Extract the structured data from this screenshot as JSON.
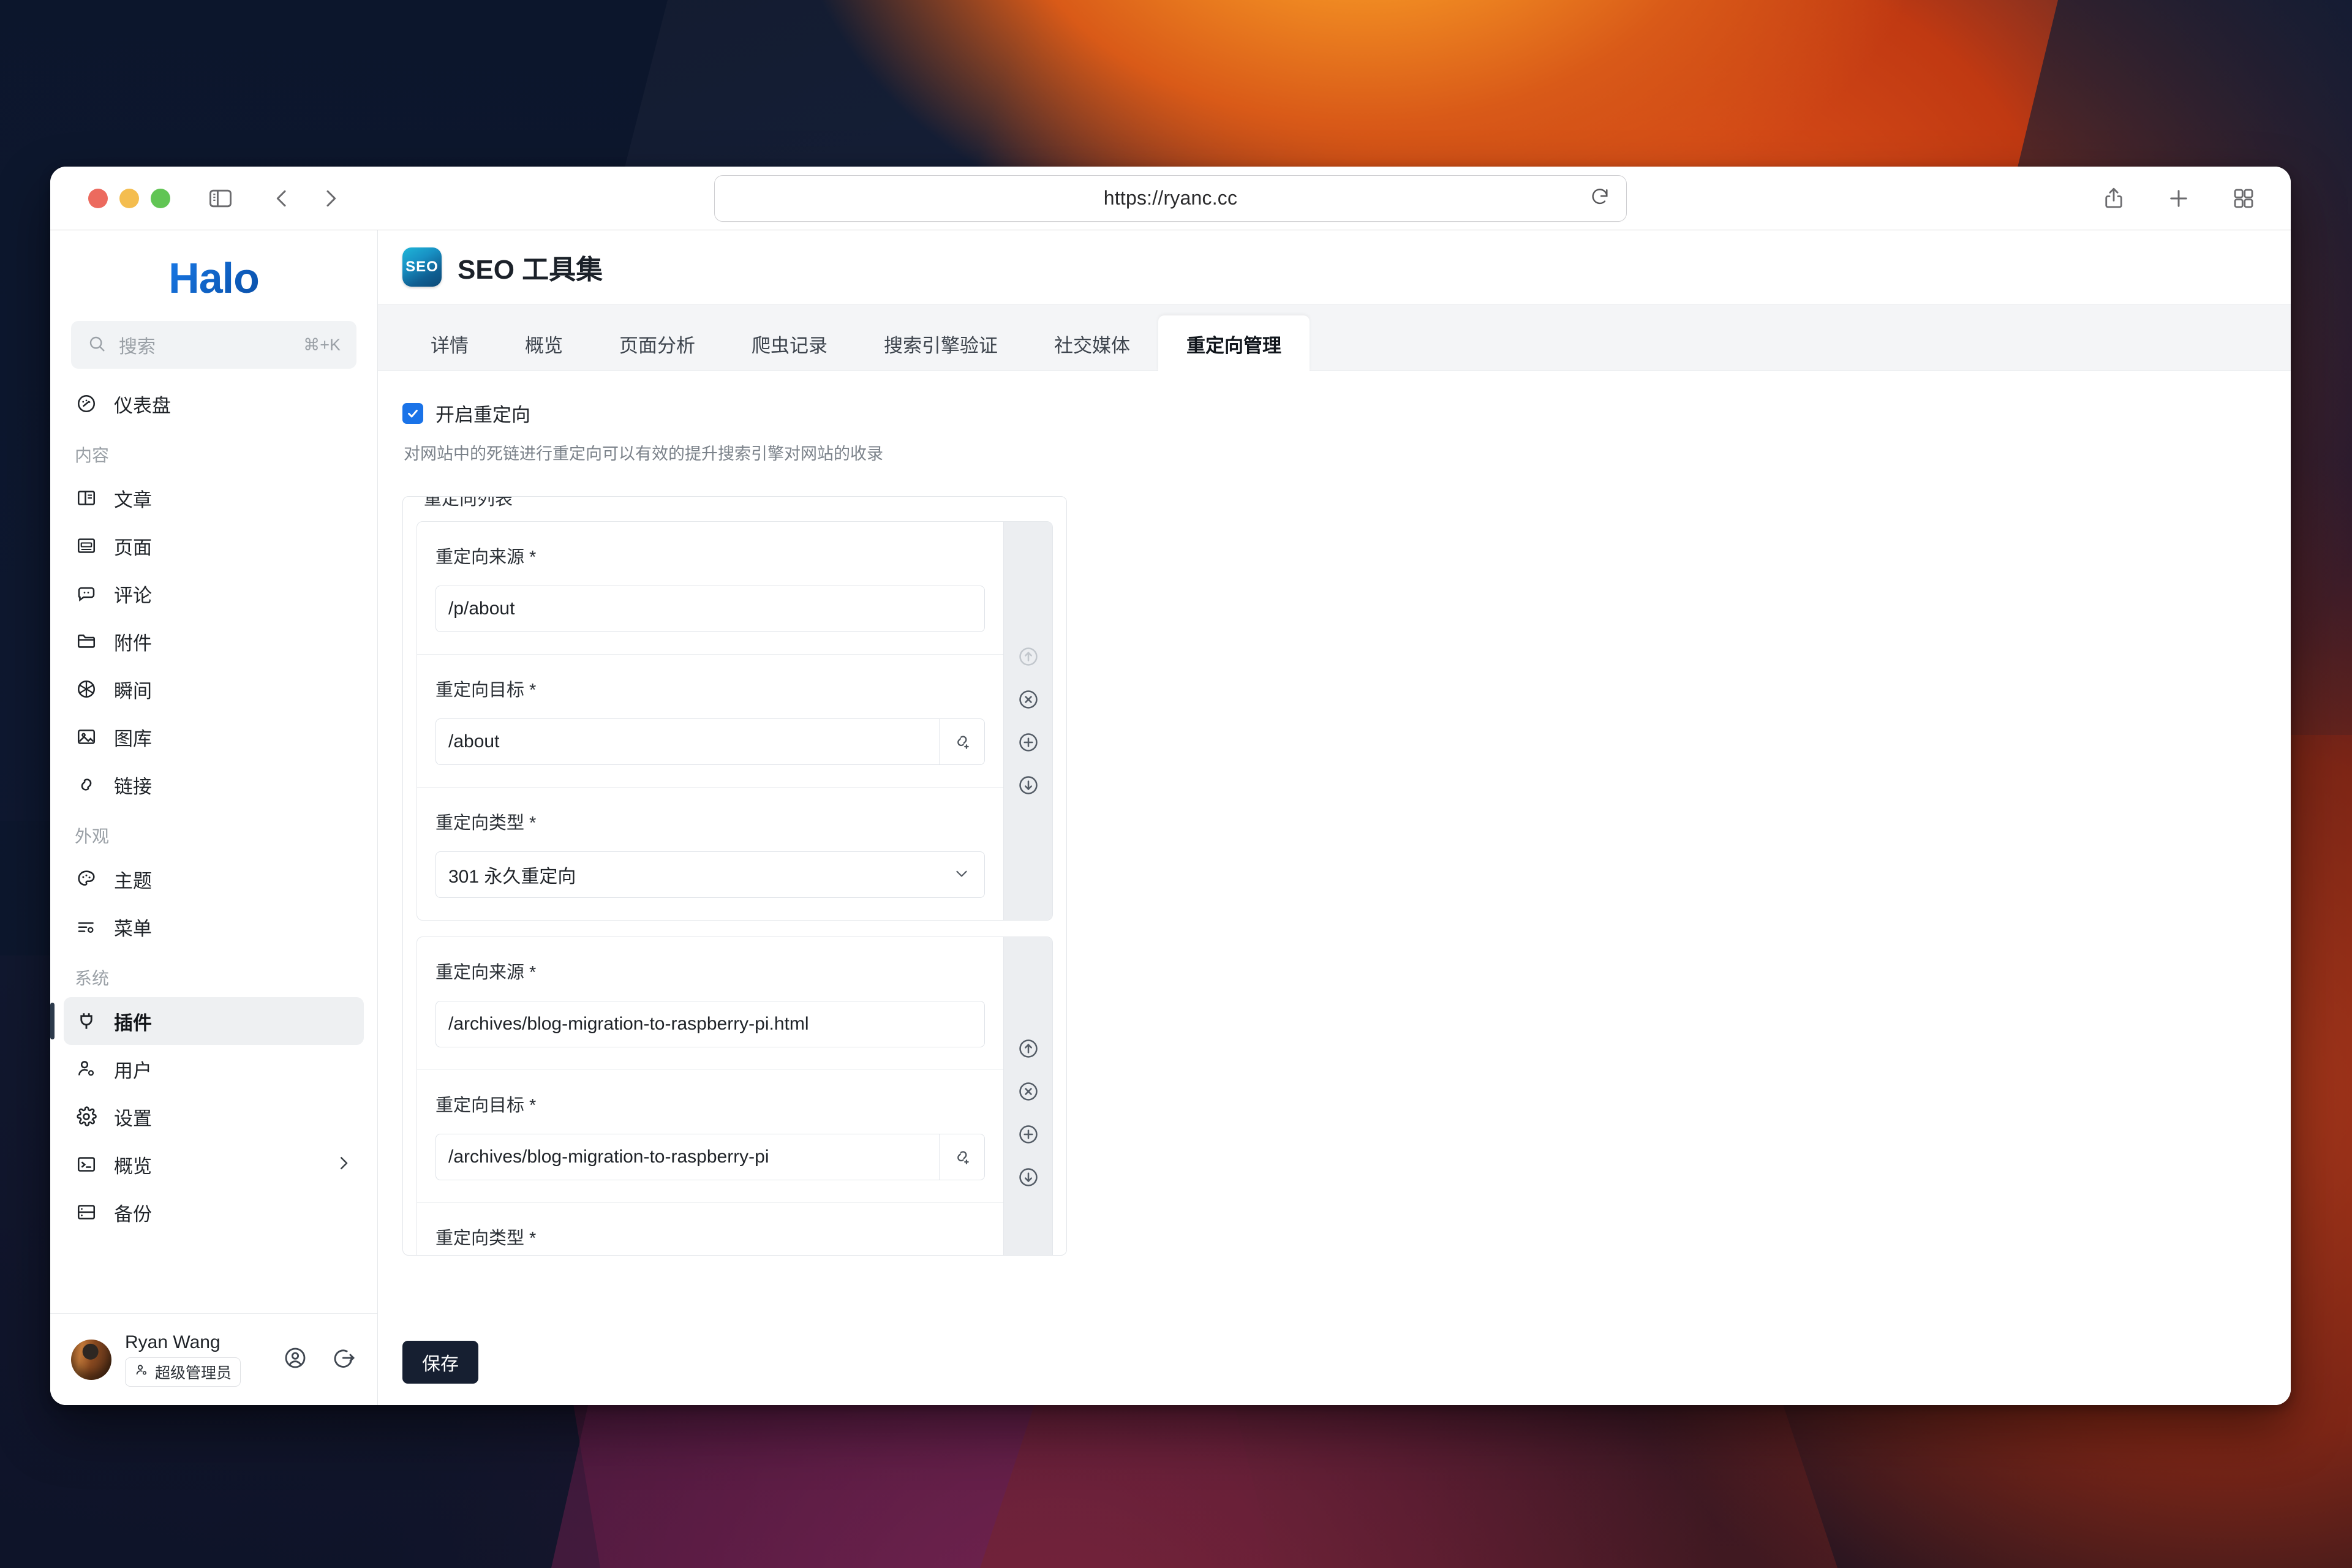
{
  "browser": {
    "url": "https://ryanc.cc",
    "icons": {
      "sidebar_toggle": "sidebar-toggle-icon",
      "back": "back-chevron-icon",
      "forward": "forward-chevron-icon",
      "reload": "reload-icon",
      "share": "share-icon",
      "new_tab": "plus-icon",
      "tab_overview": "tab-grid-icon"
    }
  },
  "sidebar": {
    "logo": "Halo",
    "search": {
      "placeholder": "搜索",
      "shortcut": "⌘+K"
    },
    "items": [
      {
        "label": "仪表盘",
        "icon": "dashboard-icon",
        "group": null,
        "active": false
      },
      {
        "label": "文章",
        "icon": "post-icon",
        "group": "内容",
        "active": false
      },
      {
        "label": "页面",
        "icon": "page-icon",
        "group": "内容",
        "active": false
      },
      {
        "label": "评论",
        "icon": "comment-icon",
        "group": "内容",
        "active": false
      },
      {
        "label": "附件",
        "icon": "folder-icon",
        "group": "内容",
        "active": false
      },
      {
        "label": "瞬间",
        "icon": "aperture-icon",
        "group": "内容",
        "active": false
      },
      {
        "label": "图库",
        "icon": "image-icon",
        "group": "内容",
        "active": false
      },
      {
        "label": "链接",
        "icon": "link-icon",
        "group": "内容",
        "active": false
      },
      {
        "label": "主题",
        "icon": "palette-icon",
        "group": "外观",
        "active": false
      },
      {
        "label": "菜单",
        "icon": "menu-settings-icon",
        "group": "外观",
        "active": false
      },
      {
        "label": "插件",
        "icon": "plug-icon",
        "group": "系统",
        "active": true
      },
      {
        "label": "用户",
        "icon": "user-settings-icon",
        "group": "系统",
        "active": false
      },
      {
        "label": "设置",
        "icon": "gear-icon",
        "group": "系统",
        "active": false
      },
      {
        "label": "概览",
        "icon": "terminal-icon",
        "group": "系统",
        "active": false,
        "chevron": true
      },
      {
        "label": "备份",
        "icon": "backup-icon",
        "group": "系统",
        "active": false
      }
    ],
    "groups": {
      "content": "内容",
      "appearance": "外观",
      "system": "系统"
    },
    "user": {
      "name": "Ryan Wang",
      "role_badge": "超级管理员",
      "role_icon": "user-role-icon",
      "profile_icon": "profile-circle-icon",
      "logout_icon": "logout-icon"
    }
  },
  "page": {
    "logo_text": "SEO",
    "title": "SEO 工具集",
    "tabs": [
      {
        "label": "详情",
        "active": false
      },
      {
        "label": "概览",
        "active": false
      },
      {
        "label": "页面分析",
        "active": false
      },
      {
        "label": "爬虫记录",
        "active": false
      },
      {
        "label": "搜索引擎验证",
        "active": false
      },
      {
        "label": "社交媒体",
        "active": false
      },
      {
        "label": "重定向管理",
        "active": true
      }
    ]
  },
  "form": {
    "enable_checkbox": {
      "label": "开启重定向",
      "checked": true
    },
    "help_text": "对网站中的死链进行重定向可以有效的提升搜索引擎对网站的收录",
    "fieldset_legend": "重定向列表",
    "labels": {
      "source": "重定向来源 *",
      "target": "重定向目标 *",
      "type": "重定向类型 *"
    },
    "redirects": [
      {
        "source": "/p/about",
        "target": "/about",
        "type": "301 永久重定向",
        "actions": {
          "up": "move-up-icon",
          "remove": "remove-icon",
          "add": "add-icon",
          "down": "move-down-icon"
        },
        "up_disabled": true
      },
      {
        "source": "/archives/blog-migration-to-raspberry-pi.html",
        "target": "/archives/blog-migration-to-raspberry-pi",
        "type": "",
        "actions": {
          "up": "move-up-icon",
          "remove": "remove-icon",
          "add": "add-icon",
          "down": "move-down-icon"
        },
        "up_disabled": false
      }
    ],
    "link_addon_icon": "link-add-icon",
    "save_label": "保存"
  }
}
